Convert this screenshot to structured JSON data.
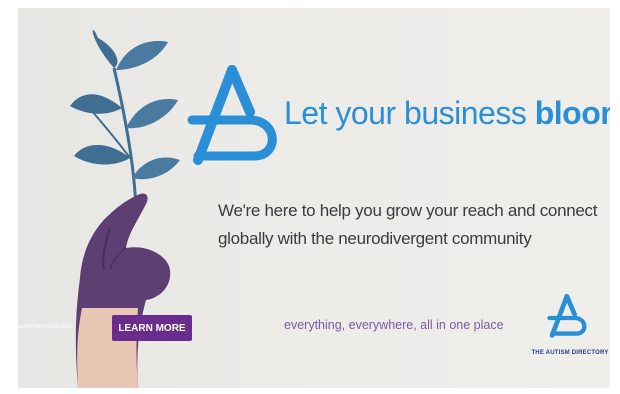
{
  "ad": {
    "headline_regular": "Let your business ",
    "headline_bold": "bloom",
    "subhead": "We're here to help you grow your reach and connect globally with the neurodivergent community",
    "tagline": "everything, everywhere, all in one place",
    "cta_label": "LEARN MORE",
    "url": "autismdirectory.com",
    "brand_name": "THE AUTISM DIRECTORY"
  },
  "colors": {
    "brand_blue": "#2a8fd6",
    "cta_purple": "#6a2d8d",
    "tagline_purple": "#7b5aa6",
    "leaf_blue": "#3f6e92",
    "glove_purple": "#5d3f73"
  },
  "icons": [
    "plant-icon",
    "autism-directory-logo-icon"
  ]
}
